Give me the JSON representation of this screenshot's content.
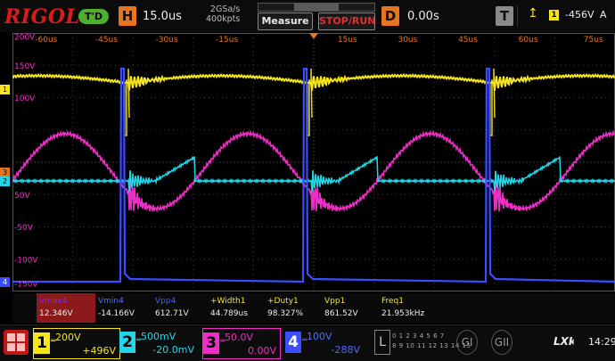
{
  "header": {
    "logo": "RIGOL",
    "run_state": "T'D",
    "horizontal": {
      "letter": "H",
      "timebase": "15.0us",
      "sample_rate": "2GSa/s",
      "memory_depth": "400kpts"
    },
    "measure_label": "Measure",
    "stoprun_label": "STOP/RUN",
    "delay": {
      "letter": "D",
      "value": "0.00s"
    },
    "trigger": {
      "letter": "T",
      "source": "1",
      "level": "-456V",
      "mode": "A",
      "edge_icon": "rising-edge-icon"
    }
  },
  "graticule": {
    "time_labels": [
      "-60us",
      "-45us",
      "-30us",
      "-15us",
      "15us",
      "30us",
      "45us",
      "60us",
      "75us"
    ],
    "volt_labels": [
      "200V",
      "150V",
      "100V",
      "50V",
      "-50V",
      "-100V",
      "-150V"
    ]
  },
  "channel_markers": {
    "ch1": "1",
    "ch2": "2",
    "ch3": "3",
    "ch4": "4"
  },
  "measurements": [
    {
      "label": "Vmax4",
      "value": "12.346V",
      "color": "#7a2cff"
    },
    {
      "label": "Vmin4",
      "value": "-14.166V",
      "color": "#4e6dff"
    },
    {
      "label": "Vpp4",
      "value": "612.71V",
      "color": "#3a63ff"
    },
    {
      "label": "+Width1",
      "value": "44.789us",
      "color": "#f5e51d"
    },
    {
      "label": "+Duty1",
      "value": "98.327%",
      "color": "#f5e51d"
    },
    {
      "label": "Vpp1",
      "value": "861.52V",
      "color": "#f5e51d"
    },
    {
      "label": "Freq1",
      "value": "21.953kHz",
      "color": "#f5e51d"
    }
  ],
  "channels": [
    {
      "num": "1",
      "scale": "200V",
      "offset": "+496V",
      "color": "#f5e51d"
    },
    {
      "num": "2",
      "scale": "500mV",
      "offset": "-20.0mV",
      "color": "#23d6e8"
    },
    {
      "num": "3",
      "scale": "50.0V",
      "offset": "0.00V",
      "color": "#ee2fc6"
    },
    {
      "num": "4",
      "scale": "100V",
      "offset": "-288V",
      "color": "#3a4dff"
    }
  ],
  "digital": {
    "letter": "L",
    "row1": "0 1 2 3 4 5 6 7",
    "row2": "8 9 10 11 12 13 14 15"
  },
  "status": {
    "g1": "GI",
    "g2": "GII",
    "lxi": "LXI",
    "time": "14:29"
  },
  "colors": {
    "ch1": "#f5e51d",
    "ch2": "#23d6e8",
    "ch3": "#ee2fc6",
    "ch4": "#3a4dff",
    "accent": "#e8741b"
  }
}
